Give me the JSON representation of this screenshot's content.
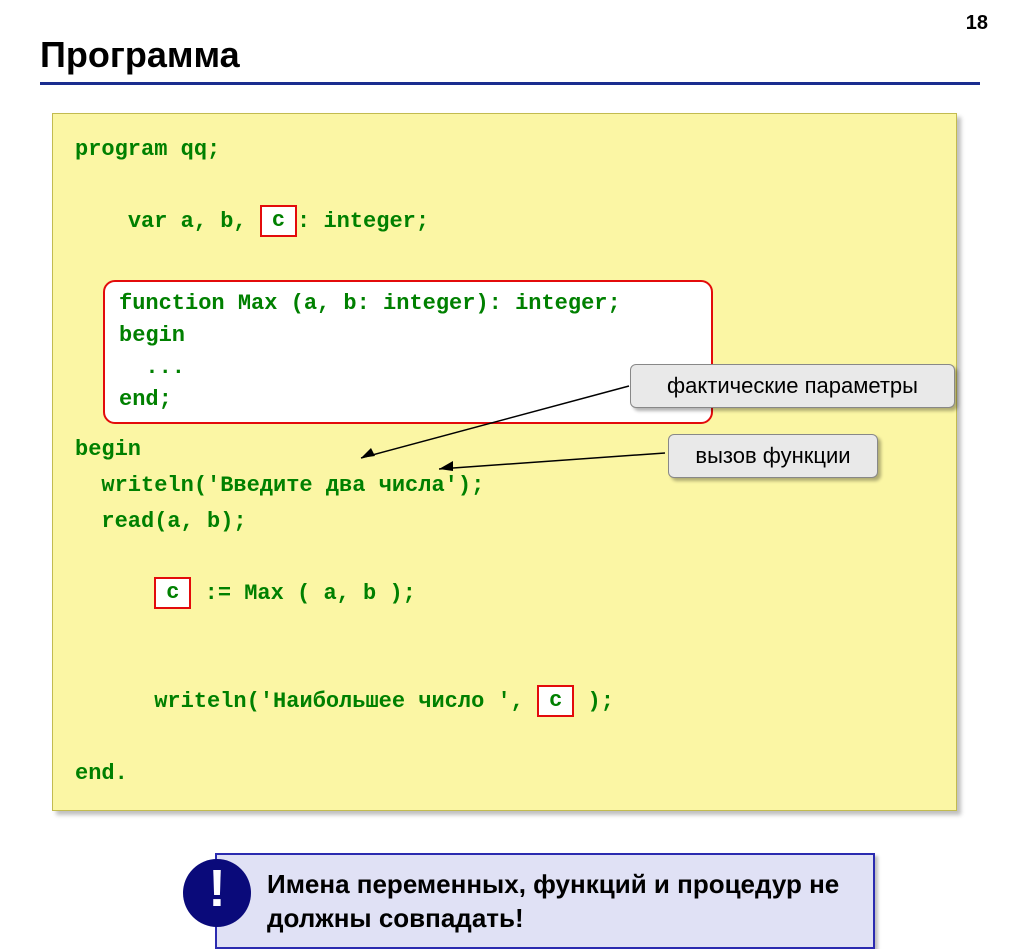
{
  "page_number": "18",
  "title": "Программа",
  "code": {
    "l1": "program qq;",
    "l2a": "var a, b, ",
    "l2b": ": integer;",
    "var_c": "c",
    "func": {
      "l1": "function Max (a, b: integer): integer;",
      "l2": "begin",
      "l3": "  ...",
      "l4": "end;"
    },
    "l3": "begin",
    "l4": "  writeln('Введите два числа');",
    "l5": "  read(a, b);",
    "l6a": "  ",
    "l6b": " := Max ( a, b );",
    "l7a": "  writeln('Наибольшее число ', ",
    "l7b": " );",
    "l8": "end."
  },
  "callouts": {
    "params": "фактические параметры",
    "call": "вызов функции"
  },
  "note": {
    "icon": "!",
    "text": "Имена переменных, функций и процедур не должны совпадать!"
  }
}
